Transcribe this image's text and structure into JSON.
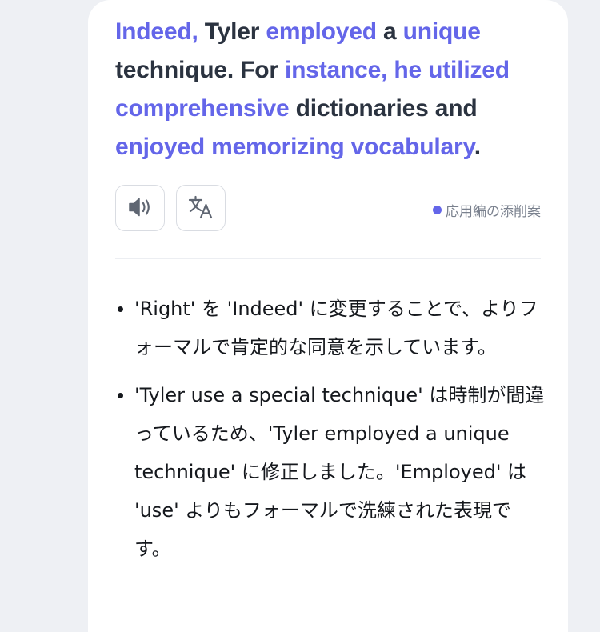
{
  "sentence": [
    {
      "text": "Indeed,",
      "hl": true
    },
    {
      "text": " ",
      "hl": false
    },
    {
      "text": "Tyler",
      "hl": false
    },
    {
      "text": " ",
      "hl": false
    },
    {
      "text": "employed",
      "hl": true
    },
    {
      "text": " a ",
      "hl": false
    },
    {
      "text": "unique",
      "hl": true
    },
    {
      "text": " technique. For ",
      "hl": false
    },
    {
      "text": "instance, he utilized comprehensive",
      "hl": true
    },
    {
      "text": " dictionaries and ",
      "hl": false
    },
    {
      "text": "enjoyed memorizing vocabulary",
      "hl": true
    },
    {
      "text": ".",
      "hl": false
    }
  ],
  "controls": {
    "audio_icon": "speaker-icon",
    "translate_icon": "translate-icon"
  },
  "tag": {
    "label": "応用編の添削案",
    "color": "#6466e9"
  },
  "notes": [
    "'Right' を 'Indeed' に変更することで、よりフォーマルで肯定的な同意を示しています。",
    "'Tyler use a special technique' は時制が間違っているため、'Tyler employed a unique technique' に修正しました。'Employed' は 'use' よりもフォーマルで洗練された表現です。"
  ],
  "colors": {
    "accent": "#6466e9",
    "text": "#2b3340"
  }
}
